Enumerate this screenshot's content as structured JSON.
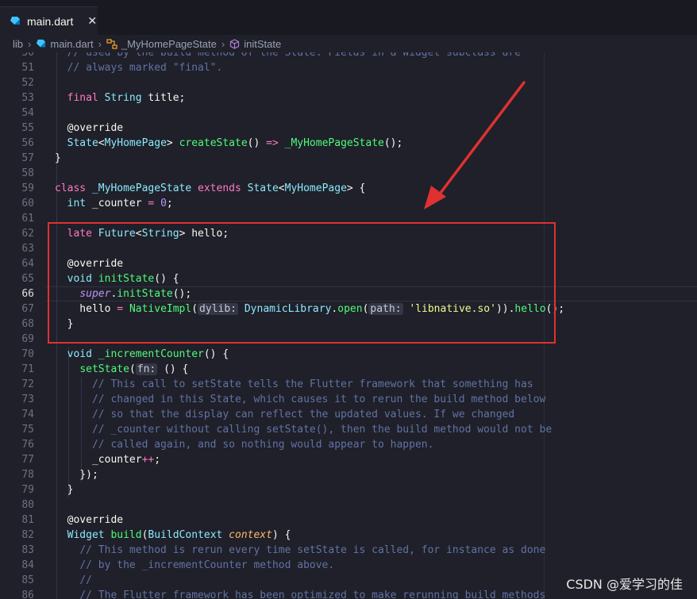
{
  "tab": {
    "label": "main.dart",
    "close_glyph": "✕",
    "icon": "dart-icon"
  },
  "breadcrumb": {
    "items": [
      "lib",
      "main.dart",
      "_MyHomePageState",
      "initState"
    ],
    "separator": "›"
  },
  "editor": {
    "lines": [
      {
        "num": "50",
        "html": "  <span class=\"c\">// used by the build method of the State. Fields in a Widget subclass are</span>"
      },
      {
        "num": "51",
        "html": "  <span class=\"c\">// always marked \"final\".</span>"
      },
      {
        "num": "52",
        "html": ""
      },
      {
        "num": "53",
        "html": "  <span class=\"k\">final</span> <span class=\"t\">String</span> title;"
      },
      {
        "num": "54",
        "html": ""
      },
      {
        "num": "55",
        "html": "  @override"
      },
      {
        "num": "56",
        "html": "  <span class=\"t\">State</span>&lt;<span class=\"t\">MyHomePage</span>&gt; <span class=\"f\">createState</span>() <span class=\"o\">=&gt;</span> <span class=\"f\">_MyHomePageState</span>();"
      },
      {
        "num": "57",
        "html": "}"
      },
      {
        "num": "58",
        "html": ""
      },
      {
        "num": "59",
        "html": "<span class=\"k\">class</span> <span class=\"t\">_MyHomePageState</span> <span class=\"k\">extends</span> <span class=\"t\">State</span>&lt;<span class=\"t\">MyHomePage</span>&gt; {"
      },
      {
        "num": "60",
        "html": "  <span class=\"t\">int</span> _counter <span class=\"o\">=</span> <span class=\"n\">0</span>;"
      },
      {
        "num": "61",
        "html": ""
      },
      {
        "num": "62",
        "html": "  <span class=\"k\">late</span> <span class=\"t\">Future</span>&lt;<span class=\"t\">String</span>&gt; hello;"
      },
      {
        "num": "63",
        "html": ""
      },
      {
        "num": "64",
        "html": "  @override"
      },
      {
        "num": "65",
        "html": "  <span class=\"t\">void</span> <span class=\"f\">initState</span>() {"
      },
      {
        "num": "66",
        "html": "    <span class=\"i\">super</span>.<span class=\"f\">initState</span>();"
      },
      {
        "num": "67",
        "html": "    hello <span class=\"o\">=</span> <span class=\"f\">NativeImpl</span>(<span class=\"hint\">dylib:</span> <span class=\"t\">DynamicLibrary</span>.<span class=\"f\">open</span>(<span class=\"hint\">path:</span> <span class=\"s\">'libnative.so'</span>)).<span class=\"f\">hello</span>();"
      },
      {
        "num": "68",
        "html": "  }"
      },
      {
        "num": "69",
        "html": ""
      },
      {
        "num": "70",
        "html": "  <span class=\"t\">void</span> <span class=\"f\">_incrementCounter</span>() {"
      },
      {
        "num": "71",
        "html": "    <span class=\"f\">setState</span>(<span class=\"hint\">fn:</span> () {"
      },
      {
        "num": "72",
        "html": "      <span class=\"c\">// This call to setState tells the Flutter framework that something has</span>"
      },
      {
        "num": "73",
        "html": "      <span class=\"c\">// changed in this State, which causes it to rerun the build method below</span>"
      },
      {
        "num": "74",
        "html": "      <span class=\"c\">// so that the display can reflect the updated values. If we changed</span>"
      },
      {
        "num": "75",
        "html": "      <span class=\"c\">// _counter without calling setState(), then the build method would not be</span>"
      },
      {
        "num": "76",
        "html": "      <span class=\"c\">// called again, and so nothing would appear to happen.</span>"
      },
      {
        "num": "77",
        "html": "      _counter<span class=\"o\">++</span>;"
      },
      {
        "num": "78",
        "html": "    });"
      },
      {
        "num": "79",
        "html": "  }"
      },
      {
        "num": "80",
        "html": ""
      },
      {
        "num": "81",
        "html": "  @override"
      },
      {
        "num": "82",
        "html": "  <span class=\"t\">Widget</span> <span class=\"f\">build</span>(<span class=\"t\">BuildContext</span> <span class=\"p\">context</span>) {"
      },
      {
        "num": "83",
        "html": "    <span class=\"c\">// This method is rerun every time setState is called, for instance as done</span>"
      },
      {
        "num": "84",
        "html": "    <span class=\"c\">// by the _incrementCounter method above.</span>"
      },
      {
        "num": "85",
        "html": "    <span class=\"c\">//</span>"
      },
      {
        "num": "86",
        "html": "    <span class=\"c\">// The Flutter framework has been optimized to make rerunning build methods</span>"
      }
    ],
    "active_line": "66"
  },
  "annotation": {
    "box_color": "#e03131",
    "arrow_color": "#e03131"
  },
  "watermark": "CSDN @爱学习的佳",
  "colors": {
    "background": "#1f2029",
    "keyword": "#ff79c6",
    "type": "#8be9fd",
    "function": "#50fa7b",
    "comment": "#6272a4",
    "string": "#f1fa8c",
    "number": "#bd93f9"
  }
}
